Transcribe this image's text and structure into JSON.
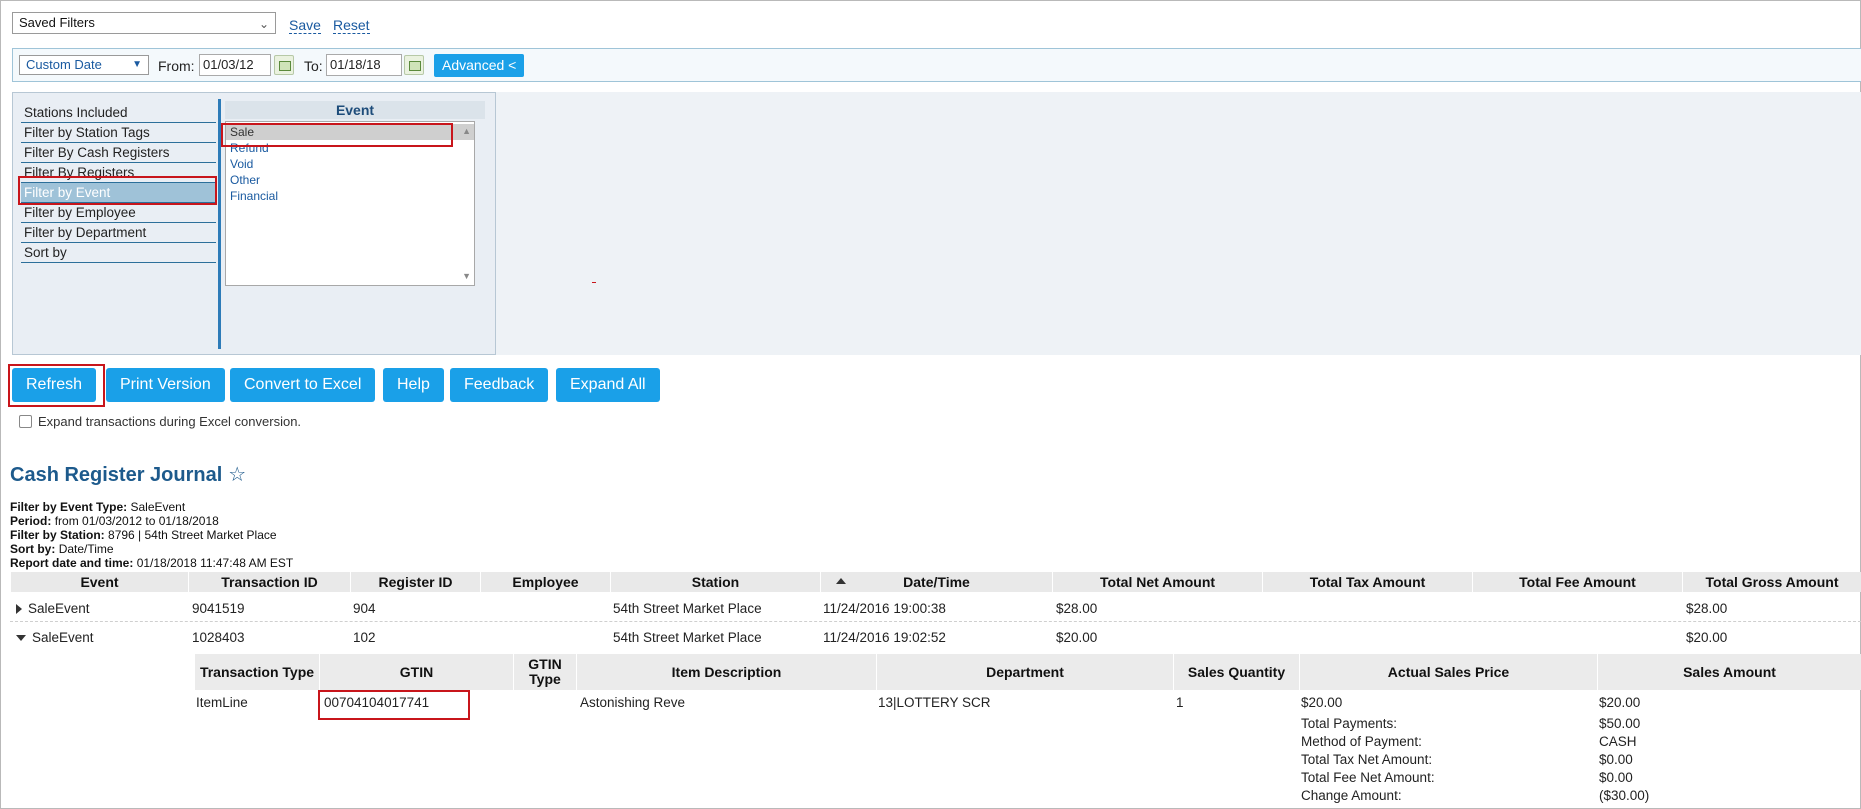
{
  "saved_filters": {
    "value": "Saved Filters",
    "save_label": "Save",
    "reset_label": "Reset"
  },
  "date_range": {
    "mode": "Custom Date",
    "from_label": "From:",
    "from_value": "01/03/12",
    "to_label": "To:",
    "to_value": "01/18/18",
    "advanced_label": "Advanced <"
  },
  "filter_menu": {
    "items": [
      "Stations Included",
      "Filter by Station Tags",
      "Filter By Cash Registers",
      "Filter By Registers",
      "Filter by Event",
      "Filter by Employee",
      "Filter by Department",
      "Sort by"
    ],
    "selected_index": 4
  },
  "event_panel": {
    "title": "Event",
    "options": [
      "Sale",
      "Refund",
      "Void",
      "Other",
      "Financial"
    ],
    "selected_index": 0
  },
  "actions": {
    "refresh": "Refresh",
    "print": "Print Version",
    "excel": "Convert to Excel",
    "help": "Help",
    "feedback": "Feedback",
    "expand": "Expand All"
  },
  "expand_checkbox_label": "Expand transactions during Excel conversion.",
  "report": {
    "title": "Cash Register Journal",
    "meta": [
      {
        "label": "Filter by Event Type:",
        "value": "SaleEvent"
      },
      {
        "label": "Period:",
        "value": "from 01/03/2012 to 01/18/2018"
      },
      {
        "label": "Filter by Station:",
        "value": "8796 | 54th Street Market Place"
      },
      {
        "label": "Sort by:",
        "value": "Date/Time"
      },
      {
        "label": "Report date and time:",
        "value": "01/18/2018 11:47:48 AM EST"
      }
    ]
  },
  "table": {
    "columns": [
      "Event",
      "Transaction ID",
      "Register ID",
      "Employee",
      "Station",
      "Date/Time",
      "Total Net Amount",
      "Total Tax Amount",
      "Total Fee Amount",
      "Total Gross Amount"
    ],
    "rows": [
      {
        "event": "SaleEvent",
        "txn_id": "9041519",
        "register_id": "904",
        "employee": "",
        "station": "54th Street Market Place",
        "datetime": "11/24/2016 19:00:38",
        "net": "$28.00",
        "tax": "",
        "fee": "",
        "gross": "$28.00",
        "expanded": false
      },
      {
        "event": "SaleEvent",
        "txn_id": "1028403",
        "register_id": "102",
        "employee": "",
        "station": "54th Street Market Place",
        "datetime": "11/24/2016 19:02:52",
        "net": "$20.00",
        "tax": "",
        "fee": "",
        "gross": "$20.00",
        "expanded": true
      }
    ]
  },
  "detail": {
    "columns": [
      "Transaction Type",
      "GTIN",
      "GTIN Type",
      "Item Description",
      "Department",
      "Sales Quantity",
      "Actual Sales Price",
      "Sales Amount"
    ],
    "line": {
      "type": "ItemLine",
      "gtin": "00704104017741",
      "gtin_type": "",
      "description": "Astonishing Reve",
      "department": "13|LOTTERY SCR",
      "quantity": "1",
      "price": "$20.00",
      "amount": "$20.00"
    },
    "summary": [
      {
        "label": "Total Payments:",
        "value": "$50.00"
      },
      {
        "label": "Method of Payment:",
        "value": "CASH"
      },
      {
        "label": "Total Tax Net Amount:",
        "value": "$0.00"
      },
      {
        "label": "Total Fee Net Amount:",
        "value": "$0.00"
      },
      {
        "label": "Change Amount:",
        "value": "($30.00)"
      }
    ]
  }
}
